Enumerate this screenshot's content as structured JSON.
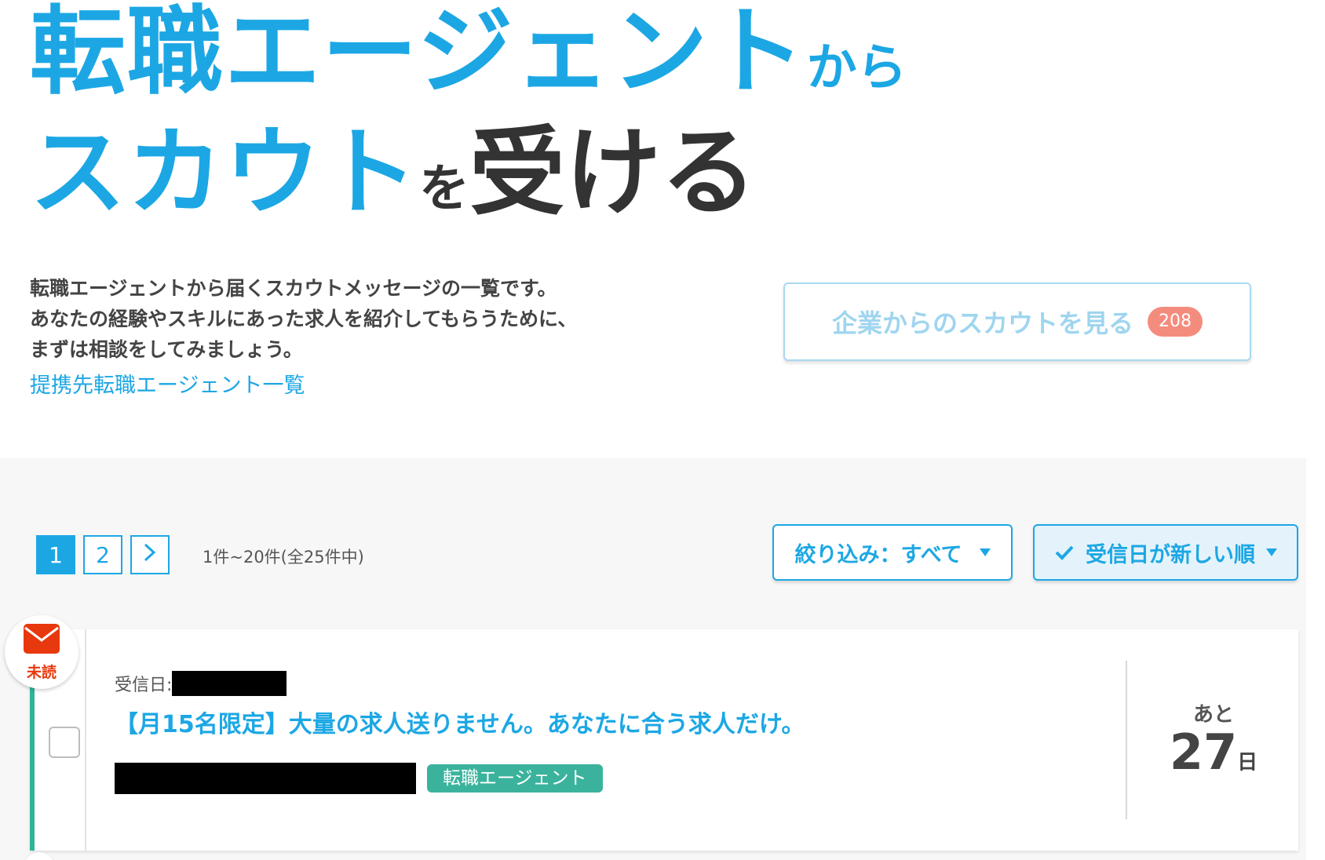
{
  "hero": {
    "line1_main": "転職エージェント",
    "line1_suffix": "から",
    "line2_main": "スカウト",
    "line2_particle": "を",
    "line2_end": "受ける"
  },
  "intro": {
    "lines": [
      "転職エージェントから届くスカウトメッセージの一覧です。",
      "あなたの経験やスキルにあった求人を紹介してもらうために、",
      "まずは相談をしてみましょう。"
    ],
    "agent_list_link": "提携先転職エージェント一覧"
  },
  "company_scout": {
    "label": "企業からのスカウトを見る",
    "count": "208"
  },
  "pagination": {
    "pages": [
      "1",
      "2"
    ],
    "current": "1",
    "info": "1件~20件(全25件中)"
  },
  "filter": {
    "label": "絞り込み：すべて"
  },
  "sort": {
    "label": "受信日が新しい順"
  },
  "messages": [
    {
      "unread_label": "未読",
      "received_label": "受信日:",
      "subject": "【月15名限定】大量の求人送りません。あなたに合う求人だけ。",
      "tag": "転職エージェント",
      "remaining_prefix": "あと",
      "remaining_days": "27",
      "remaining_unit": "日"
    }
  ],
  "colors": {
    "brand_blue": "#1ca7e4",
    "agent_green": "#3bb39c",
    "unread_red": "#e8380d",
    "badge_salmon": "#f48c7e"
  },
  "icons": [
    "mail-icon",
    "check-icon",
    "chevron-right-icon",
    "caret-down-icon"
  ]
}
